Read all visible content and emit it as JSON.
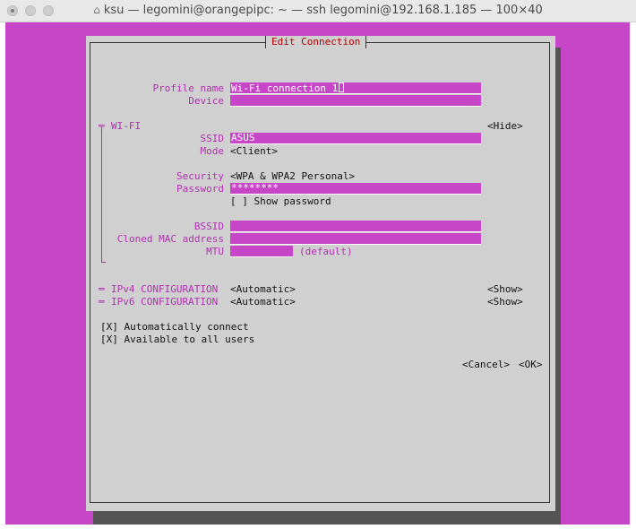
{
  "window": {
    "title": "ksu — legomini@orangepipc: ~ — ssh legomini@192.168.1.185 — 100×40"
  },
  "dialog": {
    "title": "Edit Connection"
  },
  "profile": {
    "name_label": "Profile name",
    "name_value": "Wi-Fi connection 1",
    "device_label": "Device",
    "device_value": ""
  },
  "wifi": {
    "section_label": "WI-FI",
    "hide_button": "<Hide>",
    "ssid_label": "SSID",
    "ssid_value": "ASUS",
    "mode_label": "Mode",
    "mode_value": "<Client>",
    "security_label": "Security",
    "security_value": "<WPA & WPA2 Personal>",
    "password_label": "Password",
    "password_value": "********",
    "show_password": "[ ] Show password",
    "bssid_label": "BSSID",
    "bssid_value": "",
    "cloned_mac_label": "Cloned MAC address",
    "cloned_mac_value": "",
    "mtu_label": "MTU",
    "mtu_value": "",
    "mtu_hint": "(default)"
  },
  "ipv4": {
    "label": "IPv4 CONFIGURATION",
    "value": "<Automatic>",
    "show_button": "<Show>"
  },
  "ipv6": {
    "label": "IPv6 CONFIGURATION",
    "value": "<Automatic>",
    "show_button": "<Show>"
  },
  "options": {
    "auto_connect": "[X] Automatically connect",
    "all_users": "[X] Available to all users"
  },
  "buttons": {
    "cancel": "<Cancel>",
    "ok": "<OK>"
  },
  "colors": {
    "terminal_bg": "#c745c7",
    "dialog_bg": "#d0d0d0",
    "label": "#b030b0",
    "title": "#b00000"
  },
  "icons": {
    "title_icon": "home-icon"
  }
}
